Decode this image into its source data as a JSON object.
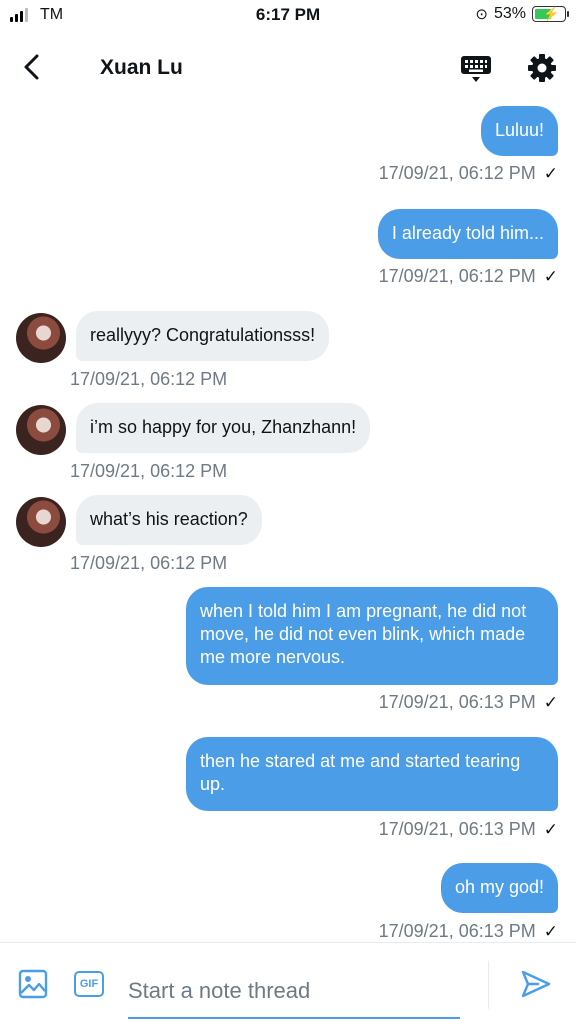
{
  "status_bar": {
    "carrier": "TM",
    "time": "6:17 PM",
    "battery": "53%"
  },
  "header": {
    "title": "Xuan Lu"
  },
  "messages": [
    {
      "dir": "out",
      "text": "Luluu!",
      "time": "17/09/21, 06:12 PM",
      "check": "✓"
    },
    {
      "dir": "out",
      "text": "I already told him...",
      "time": "17/09/21, 06:12 PM",
      "check": "✓"
    },
    {
      "dir": "in",
      "text": "reallyyy? Congratulationsss!",
      "time": "17/09/21, 06:12 PM"
    },
    {
      "dir": "in",
      "text": "i’m so happy for you, Zhanzhann!",
      "time": "17/09/21, 06:12 PM"
    },
    {
      "dir": "in",
      "text": "what’s his reaction?",
      "time": "17/09/21, 06:12 PM"
    },
    {
      "dir": "out",
      "text": "when I told him I am pregnant, he did not move, he did not even blink, which made me more nervous.",
      "time": "17/09/21, 06:13 PM",
      "check": "✓"
    },
    {
      "dir": "out",
      "text": "then he stared at me and started tearing up.",
      "time": "17/09/21, 06:13 PM",
      "check": "✓"
    },
    {
      "dir": "out",
      "text": "oh my god!",
      "time": "17/09/21, 06:13 PM",
      "check": "✓"
    }
  ],
  "composer": {
    "placeholder": "Start a note thread",
    "gif_label": "GIF"
  },
  "icons": {
    "back": "chevron-left-icon",
    "keyboard": "keyboard-icon",
    "settings": "gear-icon",
    "image": "image-icon",
    "gif": "gif-icon",
    "send": "send-icon"
  },
  "colors": {
    "accent": "#4c9de8",
    "incoming_bubble": "#eceff1",
    "timestamp": "#6e7a85"
  }
}
